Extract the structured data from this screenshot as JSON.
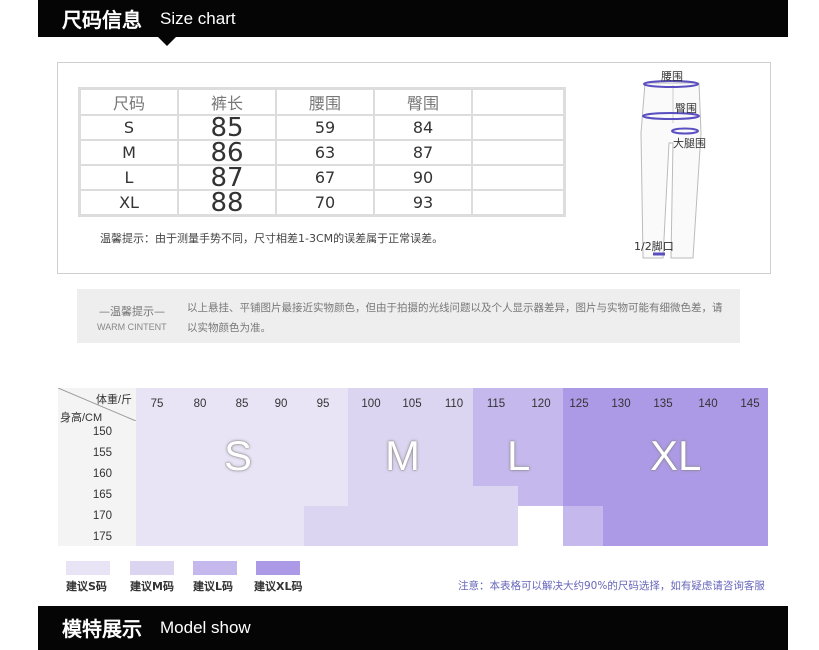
{
  "size_chart_banner": {
    "cn": "尺码信息",
    "en": "Size chart"
  },
  "size_table": {
    "headers": [
      "尺码",
      "裤长",
      "腰围",
      "臀围",
      ""
    ],
    "rows": [
      {
        "size": "S",
        "length": "85",
        "waist": "59",
        "hip": "84"
      },
      {
        "size": "M",
        "length": "86",
        "waist": "63",
        "hip": "87"
      },
      {
        "size": "L",
        "length": "87",
        "waist": "67",
        "hip": "90"
      },
      {
        "size": "XL",
        "length": "88",
        "waist": "70",
        "hip": "93"
      }
    ],
    "note": "温馨提示：由于测量手势不同，尺寸相差1-3CM的误差属于正常误差。"
  },
  "diagram": {
    "waist": "腰围",
    "hip": "臀围",
    "thigh": "大腿围",
    "leg_opening": "1/2脚口"
  },
  "warm_tip": {
    "title": "—温馨提示—",
    "en": "WARM CINTENT",
    "text": "以上悬挂、平铺图片最接近实物颜色，但由于拍摄的光线问题以及个人显示器差异，图片与实物可能有细微色差，请以实物颜色为准。"
  },
  "weight_chart": {
    "weight_header": "体重/斤",
    "height_header": "身高/CM",
    "weights": [
      "75",
      "80",
      "85",
      "90",
      "95",
      "100",
      "105",
      "110",
      "115",
      "120",
      "125",
      "130",
      "135",
      "140",
      "145"
    ],
    "heights": [
      "150",
      "155",
      "160",
      "165",
      "170",
      "175"
    ],
    "size_labels": [
      "S",
      "M",
      "L",
      "XL"
    ],
    "colors": {
      "S": "#e8e4f6",
      "M": "#dcd5f1",
      "L": "#c5b8ec",
      "XL": "#ad9ae6"
    }
  },
  "legend": [
    {
      "label": "建议S码",
      "color": "#e8e4f6"
    },
    {
      "label": "建议M码",
      "color": "#dcd5f1"
    },
    {
      "label": "建议L码",
      "color": "#c5b8ec"
    },
    {
      "label": "建议XL码",
      "color": "#ad9ae6"
    }
  ],
  "chart_note": "注意：本表格可以解决大约90%的尺码选择，如有疑虑请咨询客服",
  "model_banner": {
    "cn": "模特展示",
    "en": "Model show"
  }
}
